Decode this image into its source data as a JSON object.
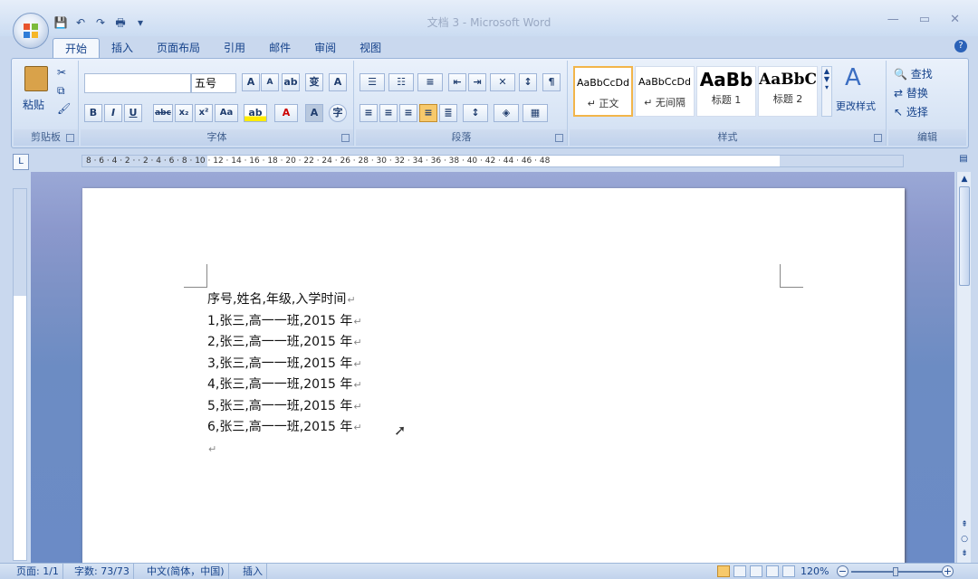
{
  "window": {
    "title": "文档 3 - Microsoft Word"
  },
  "tabs": [
    {
      "label": "开始",
      "active": true
    },
    {
      "label": "插入"
    },
    {
      "label": "页面布局"
    },
    {
      "label": "引用"
    },
    {
      "label": "邮件"
    },
    {
      "label": "审阅"
    },
    {
      "label": "视图"
    }
  ],
  "ribbon": {
    "clipboard": {
      "paste_label": "粘贴",
      "group_label": "剪贴板"
    },
    "font": {
      "font_name": "",
      "font_size": "五号",
      "group_label": "字体"
    },
    "paragraph": {
      "group_label": "段落"
    },
    "styles": {
      "items": [
        {
          "preview": "AaBbCcDd",
          "name": "↵ 正文"
        },
        {
          "preview": "AaBbCcDd",
          "name": "↵ 无间隔"
        },
        {
          "preview": "AaBb",
          "name": "标题 1"
        },
        {
          "preview": "AaBbC",
          "name": "标题 2"
        }
      ],
      "change_label": "更改样式",
      "group_label": "样式"
    },
    "editing": {
      "find_label": "查找",
      "replace_label": "替换",
      "select_label": "选择",
      "group_label": "编辑"
    }
  },
  "ruler": {
    "numbers": "8 · 6 · 4 · 2 ·   · 2 · 4 · 6 · 8 · 10 · 12 · 14 · 16 · 18 · 20 · 22 · 24 · 26 · 28 · 30 · 32 · 34 · 36 · 38 · 40 · 42 · 44 · 46 · 48"
  },
  "document": {
    "lines": [
      "序号,姓名,年级,入学时间",
      "1,张三,高一一班,2015 年",
      "2,张三,高一一班,2015 年",
      "3,张三,高一一班,2015 年",
      "4,张三,高一一班,2015 年",
      "5,张三,高一一班,2015 年",
      "6,张三,高一一班,2015 年"
    ],
    "paragraph_mark": "↵"
  },
  "status": {
    "page": "页面: 1/1",
    "words": "字数: 73/73",
    "language": "中文(简体，中国)",
    "mode": "插入",
    "zoom": "120%"
  },
  "colors": {
    "accent": "#15428b",
    "ribbon_bg": "#dde8f6",
    "selected_style": "#f2b54a"
  }
}
